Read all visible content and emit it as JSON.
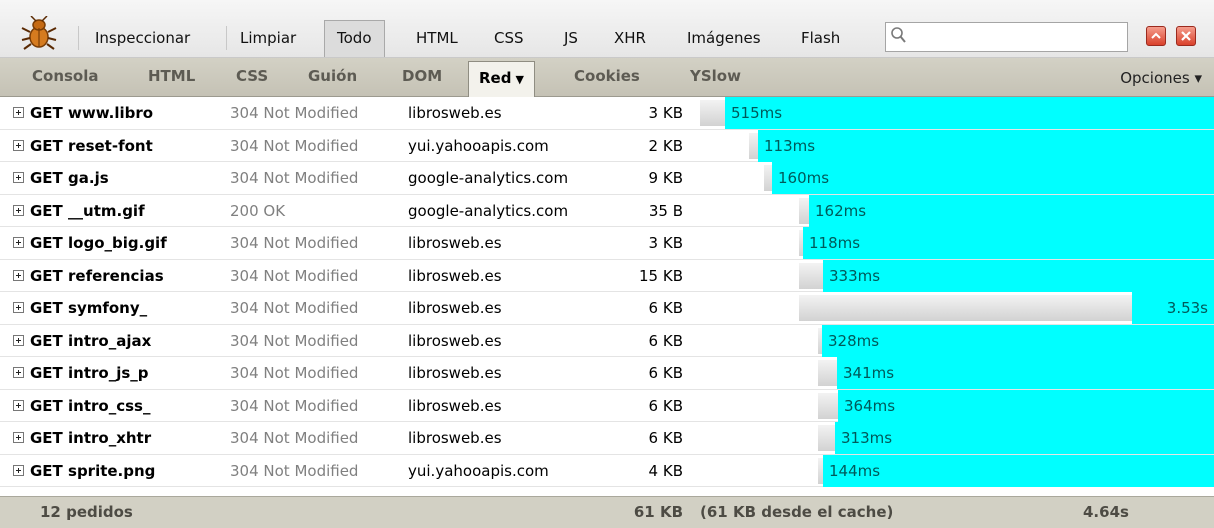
{
  "toolbar": {
    "buttons": [
      "Inspeccionar",
      "Limpiar",
      "Todo",
      "HTML",
      "CSS",
      "JS",
      "XHR",
      "Imágenes",
      "Flash"
    ],
    "active": "Todo",
    "search_value": ""
  },
  "tabs": {
    "items": [
      "Consola",
      "HTML",
      "CSS",
      "Guión",
      "DOM",
      "Red",
      "Cookies",
      "YSlow"
    ],
    "active": "Red",
    "options_label": "Opciones ▾"
  },
  "requests": [
    {
      "url": "GET www.libro",
      "status": "304 Not Modified",
      "domain": "librosweb.es",
      "size": "3 KB",
      "time": "515ms",
      "wait_start": 0.0,
      "load_start": 0.048,
      "load_end": 1.0
    },
    {
      "url": "GET reset-font",
      "status": "304 Not Modified",
      "domain": "yui.yahooapis.com",
      "size": "2 KB",
      "time": "113ms",
      "wait_start": 0.095,
      "load_start": 0.112,
      "load_end": 1.0
    },
    {
      "url": "GET ga.js",
      "status": "304 Not Modified",
      "domain": "google-analytics.com",
      "size": "9 KB",
      "time": "160ms",
      "wait_start": 0.125,
      "load_start": 0.14,
      "load_end": 1.0
    },
    {
      "url": "GET __utm.gif",
      "status": "200 OK",
      "domain": "google-analytics.com",
      "size": "35 B",
      "time": "162ms",
      "wait_start": 0.193,
      "load_start": 0.213,
      "load_end": 1.0
    },
    {
      "url": "GET logo_big.gif",
      "status": "304 Not Modified",
      "domain": "librosweb.es",
      "size": "3 KB",
      "time": "118ms",
      "wait_start": 0.193,
      "load_start": 0.2,
      "load_end": 1.0
    },
    {
      "url": "GET referencias",
      "status": "304 Not Modified",
      "domain": "librosweb.es",
      "size": "15 KB",
      "time": "333ms",
      "wait_start": 0.193,
      "load_start": 0.24,
      "load_end": 1.0
    },
    {
      "url": "GET symfony_",
      "status": "304 Not Modified",
      "domain": "librosweb.es",
      "size": "6 KB",
      "time": "3.53s",
      "wait_start": 0.193,
      "load_start": 0.84,
      "load_end": 1.0
    },
    {
      "url": "GET intro_ajax",
      "status": "304 Not Modified",
      "domain": "librosweb.es",
      "size": "6 KB",
      "time": "328ms",
      "wait_start": 0.23,
      "load_start": 0.238,
      "load_end": 1.0
    },
    {
      "url": "GET intro_js_p",
      "status": "304 Not Modified",
      "domain": "librosweb.es",
      "size": "6 KB",
      "time": "341ms",
      "wait_start": 0.23,
      "load_start": 0.267,
      "load_end": 1.0
    },
    {
      "url": "GET intro_css_",
      "status": "304 Not Modified",
      "domain": "librosweb.es",
      "size": "6 KB",
      "time": "364ms",
      "wait_start": 0.23,
      "load_start": 0.268,
      "load_end": 1.0
    },
    {
      "url": "GET intro_xhtr",
      "status": "304 Not Modified",
      "domain": "librosweb.es",
      "size": "6 KB",
      "time": "313ms",
      "wait_start": 0.23,
      "load_start": 0.263,
      "load_end": 1.0
    },
    {
      "url": "GET sprite.png",
      "status": "304 Not Modified",
      "domain": "yui.yahooapis.com",
      "size": "4 KB",
      "time": "144ms",
      "wait_start": 0.23,
      "load_start": 0.24,
      "load_end": 1.0
    }
  ],
  "summary": {
    "count": "12 pedidos",
    "size": "61 KB",
    "cache": "(61 KB desde el cache)",
    "time": "4.64s"
  }
}
